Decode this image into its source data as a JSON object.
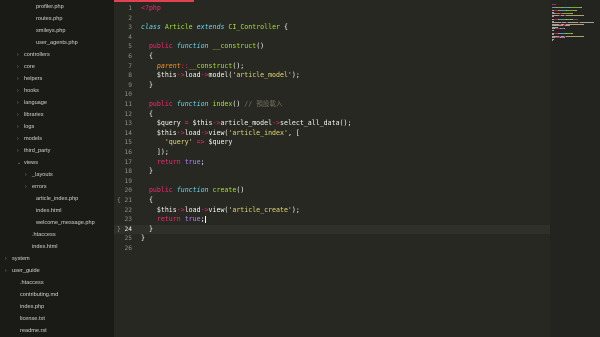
{
  "sidebar": {
    "items": [
      {
        "label": "profiler.php",
        "indent": 2,
        "folder": false,
        "open": false
      },
      {
        "label": "routes.php",
        "indent": 2,
        "folder": false,
        "open": false
      },
      {
        "label": "smileys.php",
        "indent": 2,
        "folder": false,
        "open": false
      },
      {
        "label": "user_agents.php",
        "indent": 2,
        "folder": false,
        "open": false
      },
      {
        "label": "controllers",
        "indent": 1,
        "folder": true,
        "open": false
      },
      {
        "label": "core",
        "indent": 1,
        "folder": true,
        "open": false
      },
      {
        "label": "helpers",
        "indent": 1,
        "folder": true,
        "open": false
      },
      {
        "label": "hooks",
        "indent": 1,
        "folder": true,
        "open": false
      },
      {
        "label": "language",
        "indent": 1,
        "folder": true,
        "open": false
      },
      {
        "label": "libraries",
        "indent": 1,
        "folder": true,
        "open": false
      },
      {
        "label": "logs",
        "indent": 1,
        "folder": true,
        "open": false
      },
      {
        "label": "models",
        "indent": 1,
        "folder": true,
        "open": false
      },
      {
        "label": "third_party",
        "indent": 1,
        "folder": true,
        "open": false
      },
      {
        "label": "views",
        "indent": 1,
        "folder": true,
        "open": true
      },
      {
        "label": "_layouts",
        "indent": 2,
        "folder": true,
        "open": false
      },
      {
        "label": "errors",
        "indent": 2,
        "folder": true,
        "open": false
      },
      {
        "label": "article_index.php",
        "indent": 2,
        "folder": false,
        "open": false
      },
      {
        "label": "index.html",
        "indent": 2,
        "folder": false,
        "open": false
      },
      {
        "label": "welcome_message.php",
        "indent": 2,
        "folder": false,
        "open": false
      },
      {
        "label": ".htaccess",
        "indent": 1,
        "folder": false,
        "open": false
      },
      {
        "label": "index.html",
        "indent": 1,
        "folder": false,
        "open": false
      },
      {
        "label": "system",
        "indent": 0,
        "folder": true,
        "open": false
      },
      {
        "label": "user_guide",
        "indent": 0,
        "folder": true,
        "open": false
      },
      {
        "label": ".htaccess",
        "indent": 0,
        "folder": false,
        "open": false
      },
      {
        "label": "contributing.md",
        "indent": 0,
        "folder": false,
        "open": false
      },
      {
        "label": "index.php",
        "indent": 0,
        "folder": false,
        "open": false
      },
      {
        "label": "license.txt",
        "indent": 0,
        "folder": false,
        "open": false
      },
      {
        "label": "readme.rst",
        "indent": 0,
        "folder": false,
        "open": false
      }
    ]
  },
  "editor": {
    "current_line": 24,
    "fold_markers": [
      {
        "line": 21,
        "text": "{"
      },
      {
        "line": 24,
        "text": "}"
      }
    ],
    "lines": [
      {
        "n": "1",
        "tokens": [
          [
            "kw",
            "<?php"
          ]
        ]
      },
      {
        "n": "2",
        "tokens": []
      },
      {
        "n": "3",
        "tokens": [
          [
            "st",
            "class"
          ],
          [
            "pl",
            " "
          ],
          [
            "cl",
            "Article"
          ],
          [
            "pl",
            " "
          ],
          [
            "st",
            "extends"
          ],
          [
            "pl",
            " "
          ],
          [
            "cl",
            "CI_Controller"
          ],
          [
            "pl",
            " {"
          ]
        ]
      },
      {
        "n": "4",
        "tokens": []
      },
      {
        "n": "5",
        "tokens": [
          [
            "pl",
            "  "
          ],
          [
            "kw",
            "public"
          ],
          [
            "pl",
            " "
          ],
          [
            "st",
            "function"
          ],
          [
            "pl",
            " "
          ],
          [
            "fn",
            "__construct"
          ],
          [
            "pl",
            "()"
          ]
        ]
      },
      {
        "n": "6",
        "tokens": [
          [
            "pl",
            "  {"
          ]
        ]
      },
      {
        "n": "7",
        "tokens": [
          [
            "pl",
            "    "
          ],
          [
            "par",
            "parent"
          ],
          [
            "op",
            "::"
          ],
          [
            "fn",
            "__construct"
          ],
          [
            "pl",
            "();"
          ]
        ]
      },
      {
        "n": "8",
        "tokens": [
          [
            "pl",
            "    $this"
          ],
          [
            "op",
            "->"
          ],
          [
            "pl",
            "load"
          ],
          [
            "op",
            "->"
          ],
          [
            "pl",
            "model("
          ],
          [
            "str",
            "'article_model'"
          ],
          [
            "pl",
            ");"
          ]
        ]
      },
      {
        "n": "9",
        "tokens": [
          [
            "pl",
            "  }"
          ]
        ]
      },
      {
        "n": "10",
        "tokens": []
      },
      {
        "n": "11",
        "tokens": [
          [
            "pl",
            "  "
          ],
          [
            "kw",
            "public"
          ],
          [
            "pl",
            " "
          ],
          [
            "st",
            "function"
          ],
          [
            "pl",
            " "
          ],
          [
            "fn",
            "index"
          ],
          [
            "pl",
            "() "
          ],
          [
            "cm",
            "// 預設載入"
          ]
        ]
      },
      {
        "n": "12",
        "tokens": [
          [
            "pl",
            "  {"
          ]
        ]
      },
      {
        "n": "13",
        "tokens": [
          [
            "pl",
            "    $query "
          ],
          [
            "op",
            "="
          ],
          [
            "pl",
            " $this"
          ],
          [
            "op",
            "->"
          ],
          [
            "pl",
            "article_model"
          ],
          [
            "op",
            "->"
          ],
          [
            "pl",
            "select_all_data();"
          ]
        ]
      },
      {
        "n": "14",
        "tokens": [
          [
            "pl",
            "    $this"
          ],
          [
            "op",
            "->"
          ],
          [
            "pl",
            "load"
          ],
          [
            "op",
            "->"
          ],
          [
            "pl",
            "view("
          ],
          [
            "str",
            "'article_index'"
          ],
          [
            "pl",
            ", ["
          ]
        ]
      },
      {
        "n": "15",
        "tokens": [
          [
            "pl",
            "      "
          ],
          [
            "str",
            "'query'"
          ],
          [
            "pl",
            " "
          ],
          [
            "op",
            "=>"
          ],
          [
            "pl",
            " $query"
          ]
        ]
      },
      {
        "n": "16",
        "tokens": [
          [
            "pl",
            "    ]);"
          ]
        ]
      },
      {
        "n": "17",
        "tokens": [
          [
            "pl",
            "    "
          ],
          [
            "kw",
            "return"
          ],
          [
            "pl",
            " "
          ],
          [
            "con",
            "true"
          ],
          [
            "pl",
            ";"
          ]
        ]
      },
      {
        "n": "18",
        "tokens": [
          [
            "pl",
            "  }"
          ]
        ]
      },
      {
        "n": "19",
        "tokens": []
      },
      {
        "n": "20",
        "tokens": [
          [
            "pl",
            "  "
          ],
          [
            "kw",
            "public"
          ],
          [
            "pl",
            " "
          ],
          [
            "st",
            "function"
          ],
          [
            "pl",
            " "
          ],
          [
            "fn",
            "create"
          ],
          [
            "pl",
            "()"
          ]
        ]
      },
      {
        "n": "21",
        "tokens": [
          [
            "pl",
            "  {"
          ]
        ]
      },
      {
        "n": "22",
        "tokens": [
          [
            "pl",
            "    $this"
          ],
          [
            "op",
            "->"
          ],
          [
            "pl",
            "load"
          ],
          [
            "op",
            "->"
          ],
          [
            "pl",
            "view("
          ],
          [
            "str",
            "'article_create'"
          ],
          [
            "pl",
            ");"
          ]
        ]
      },
      {
        "n": "23",
        "tokens": [
          [
            "pl",
            "    "
          ],
          [
            "kw",
            "return"
          ],
          [
            "pl",
            " "
          ],
          [
            "con",
            "true"
          ],
          [
            "pl",
            ";"
          ]
        ]
      },
      {
        "n": "24",
        "tokens": [
          [
            "pl",
            "  }"
          ]
        ]
      },
      {
        "n": "25",
        "tokens": [
          [
            "pl",
            "}"
          ]
        ]
      },
      {
        "n": "26",
        "tokens": []
      }
    ]
  },
  "colors": {
    "background": "#272822",
    "sidebar": "#1a1b17",
    "keyword": "#f92672",
    "storage": "#66d9ef",
    "function": "#a6e22e",
    "string": "#e6db74",
    "comment": "#75715e",
    "constant": "#ae81ff",
    "tab_accent": "#e0434f"
  }
}
